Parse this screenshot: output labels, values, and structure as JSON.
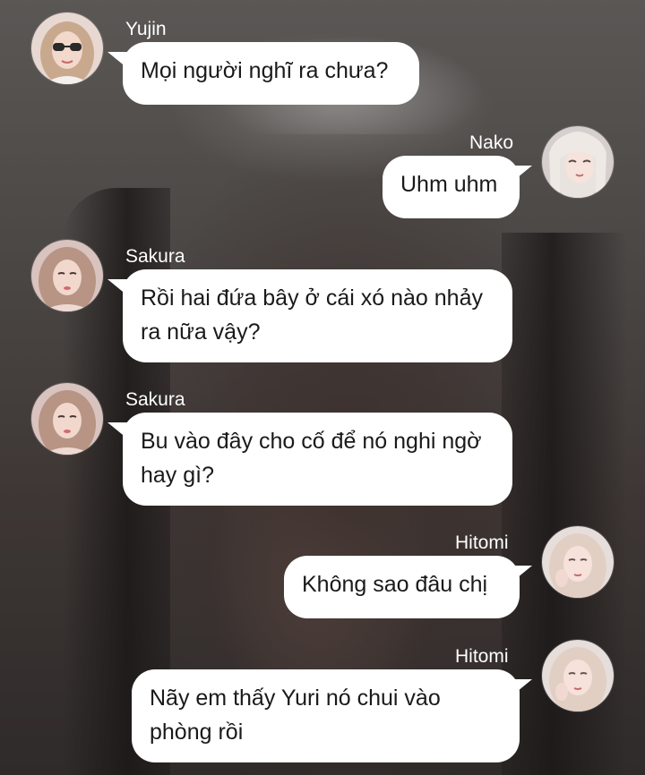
{
  "messages": [
    {
      "sender": "Yujin",
      "text": "Mọi người nghĩ ra chưa?",
      "side": "left",
      "avatar_icon": "avatar-yujin-sunglasses"
    },
    {
      "sender": "Nako",
      "text": "Uhm uhm",
      "side": "right",
      "avatar_icon": "avatar-nako"
    },
    {
      "sender": "Sakura",
      "text": "Rồi hai đứa bây ở cái xó nào nhảy ra nữa vậy?",
      "side": "left",
      "avatar_icon": "avatar-sakura"
    },
    {
      "sender": "Sakura",
      "text": "Bu vào đây cho cố để nó nghi ngờ hay gì?",
      "side": "left",
      "avatar_icon": "avatar-sakura"
    },
    {
      "sender": "Hitomi",
      "text": "Không sao đâu chị",
      "side": "right",
      "avatar_icon": "avatar-hitomi"
    },
    {
      "sender": "Hitomi",
      "text": "Nãy em thấy Yuri nó chui vào phòng rồi",
      "side": "right",
      "avatar_icon": "avatar-hitomi"
    }
  ],
  "colors": {
    "bubble": "#ffffff",
    "bubble_text": "#1a1a1a",
    "name_text": "#ffffff"
  }
}
